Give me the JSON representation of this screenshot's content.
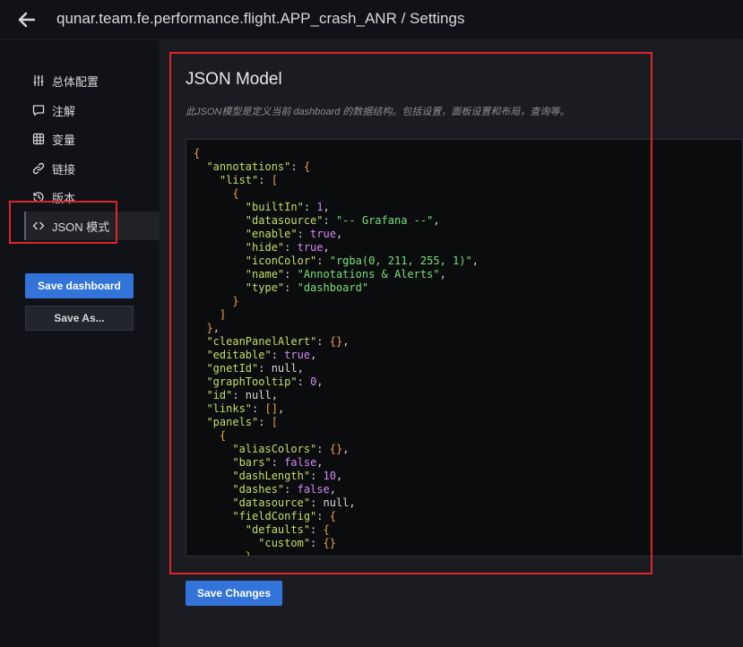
{
  "header": {
    "title": "qunar.team.fe.performance.flight.APP_crash_ANR / Settings",
    "back_icon": "arrow-left-icon"
  },
  "sidebar": {
    "items": [
      {
        "label": "总体配置",
        "icon": "sliders-icon"
      },
      {
        "label": "注解",
        "icon": "comment-icon"
      },
      {
        "label": "变量",
        "icon": "grid-icon"
      },
      {
        "label": "链接",
        "icon": "link-icon"
      },
      {
        "label": "版本",
        "icon": "history-icon"
      },
      {
        "label": "JSON 模式",
        "icon": "code-icon",
        "active": true
      }
    ],
    "save_dashboard": "Save dashboard",
    "save_as": "Save As..."
  },
  "main": {
    "title": "JSON Model",
    "description": "此JSON模型是定义当前 dashboard 的数据结构。包括设置，面板设置和布局，查询等。",
    "save_changes": "Save Changes"
  },
  "json_lines": [
    [
      [
        "b",
        "{"
      ]
    ],
    [
      [
        "t",
        "  "
      ],
      [
        "k",
        "\"annotations\""
      ],
      [
        "t",
        ": "
      ],
      [
        "b",
        "{"
      ]
    ],
    [
      [
        "t",
        "    "
      ],
      [
        "k",
        "\"list\""
      ],
      [
        "t",
        ": "
      ],
      [
        "b",
        "["
      ]
    ],
    [
      [
        "t",
        "      "
      ],
      [
        "b",
        "{"
      ]
    ],
    [
      [
        "t",
        "        "
      ],
      [
        "k",
        "\"builtIn\""
      ],
      [
        "t",
        ": "
      ],
      [
        "n",
        "1"
      ],
      [
        "t",
        ","
      ]
    ],
    [
      [
        "t",
        "        "
      ],
      [
        "k",
        "\"datasource\""
      ],
      [
        "t",
        ": "
      ],
      [
        "s",
        "\"-- Grafana --\""
      ],
      [
        "t",
        ","
      ]
    ],
    [
      [
        "t",
        "        "
      ],
      [
        "k",
        "\"enable\""
      ],
      [
        "t",
        ": "
      ],
      [
        "n",
        "true"
      ],
      [
        "t",
        ","
      ]
    ],
    [
      [
        "t",
        "        "
      ],
      [
        "k",
        "\"hide\""
      ],
      [
        "t",
        ": "
      ],
      [
        "n",
        "true"
      ],
      [
        "t",
        ","
      ]
    ],
    [
      [
        "t",
        "        "
      ],
      [
        "k",
        "\"iconColor\""
      ],
      [
        "t",
        ": "
      ],
      [
        "s",
        "\"rgba(0, 211, 255, 1)\""
      ],
      [
        "t",
        ","
      ]
    ],
    [
      [
        "t",
        "        "
      ],
      [
        "k",
        "\"name\""
      ],
      [
        "t",
        ": "
      ],
      [
        "s",
        "\"Annotations & Alerts\""
      ],
      [
        "t",
        ","
      ]
    ],
    [
      [
        "t",
        "        "
      ],
      [
        "k",
        "\"type\""
      ],
      [
        "t",
        ": "
      ],
      [
        "s",
        "\"dashboard\""
      ]
    ],
    [
      [
        "t",
        "      "
      ],
      [
        "b",
        "}"
      ]
    ],
    [
      [
        "t",
        "    "
      ],
      [
        "b",
        "]"
      ]
    ],
    [
      [
        "t",
        "  "
      ],
      [
        "b",
        "}"
      ],
      [
        "t",
        ","
      ]
    ],
    [
      [
        "t",
        "  "
      ],
      [
        "k",
        "\"cleanPanelAlert\""
      ],
      [
        "t",
        ": "
      ],
      [
        "b",
        "{}"
      ],
      [
        "t",
        ","
      ]
    ],
    [
      [
        "t",
        "  "
      ],
      [
        "k",
        "\"editable\""
      ],
      [
        "t",
        ": "
      ],
      [
        "n",
        "true"
      ],
      [
        "t",
        ","
      ]
    ],
    [
      [
        "t",
        "  "
      ],
      [
        "k",
        "\"gnetId\""
      ],
      [
        "t",
        ": null,"
      ]
    ],
    [
      [
        "t",
        "  "
      ],
      [
        "k",
        "\"graphTooltip\""
      ],
      [
        "t",
        ": "
      ],
      [
        "n",
        "0"
      ],
      [
        "t",
        ","
      ]
    ],
    [
      [
        "t",
        "  "
      ],
      [
        "k",
        "\"id\""
      ],
      [
        "t",
        ": null,"
      ]
    ],
    [
      [
        "t",
        "  "
      ],
      [
        "k",
        "\"links\""
      ],
      [
        "t",
        ": "
      ],
      [
        "b",
        "[]"
      ],
      [
        "t",
        ","
      ]
    ],
    [
      [
        "t",
        "  "
      ],
      [
        "k",
        "\"panels\""
      ],
      [
        "t",
        ": "
      ],
      [
        "b",
        "["
      ]
    ],
    [
      [
        "t",
        "    "
      ],
      [
        "b",
        "{"
      ]
    ],
    [
      [
        "t",
        "      "
      ],
      [
        "k",
        "\"aliasColors\""
      ],
      [
        "t",
        ": "
      ],
      [
        "b",
        "{}"
      ],
      [
        "t",
        ","
      ]
    ],
    [
      [
        "t",
        "      "
      ],
      [
        "k",
        "\"bars\""
      ],
      [
        "t",
        ": "
      ],
      [
        "n",
        "false"
      ],
      [
        "t",
        ","
      ]
    ],
    [
      [
        "t",
        "      "
      ],
      [
        "k",
        "\"dashLength\""
      ],
      [
        "t",
        ": "
      ],
      [
        "n",
        "10"
      ],
      [
        "t",
        ","
      ]
    ],
    [
      [
        "t",
        "      "
      ],
      [
        "k",
        "\"dashes\""
      ],
      [
        "t",
        ": "
      ],
      [
        "n",
        "false"
      ],
      [
        "t",
        ","
      ]
    ],
    [
      [
        "t",
        "      "
      ],
      [
        "k",
        "\"datasource\""
      ],
      [
        "t",
        ": null,"
      ]
    ],
    [
      [
        "t",
        "      "
      ],
      [
        "k",
        "\"fieldConfig\""
      ],
      [
        "t",
        ": "
      ],
      [
        "b",
        "{"
      ]
    ],
    [
      [
        "t",
        "        "
      ],
      [
        "k",
        "\"defaults\""
      ],
      [
        "t",
        ": "
      ],
      [
        "b",
        "{"
      ]
    ],
    [
      [
        "t",
        "          "
      ],
      [
        "k",
        "\"custom\""
      ],
      [
        "t",
        ": "
      ],
      [
        "b",
        "{}"
      ]
    ],
    [
      [
        "t",
        "        "
      ],
      [
        "b",
        "}"
      ]
    ]
  ],
  "colors": {
    "accent": "#3274d9",
    "highlight": "#e0242b",
    "json_key": "#c8dc63",
    "json_string": "#79e07a",
    "json_number": "#d38bf0",
    "json_bracket": "#f0a042"
  }
}
